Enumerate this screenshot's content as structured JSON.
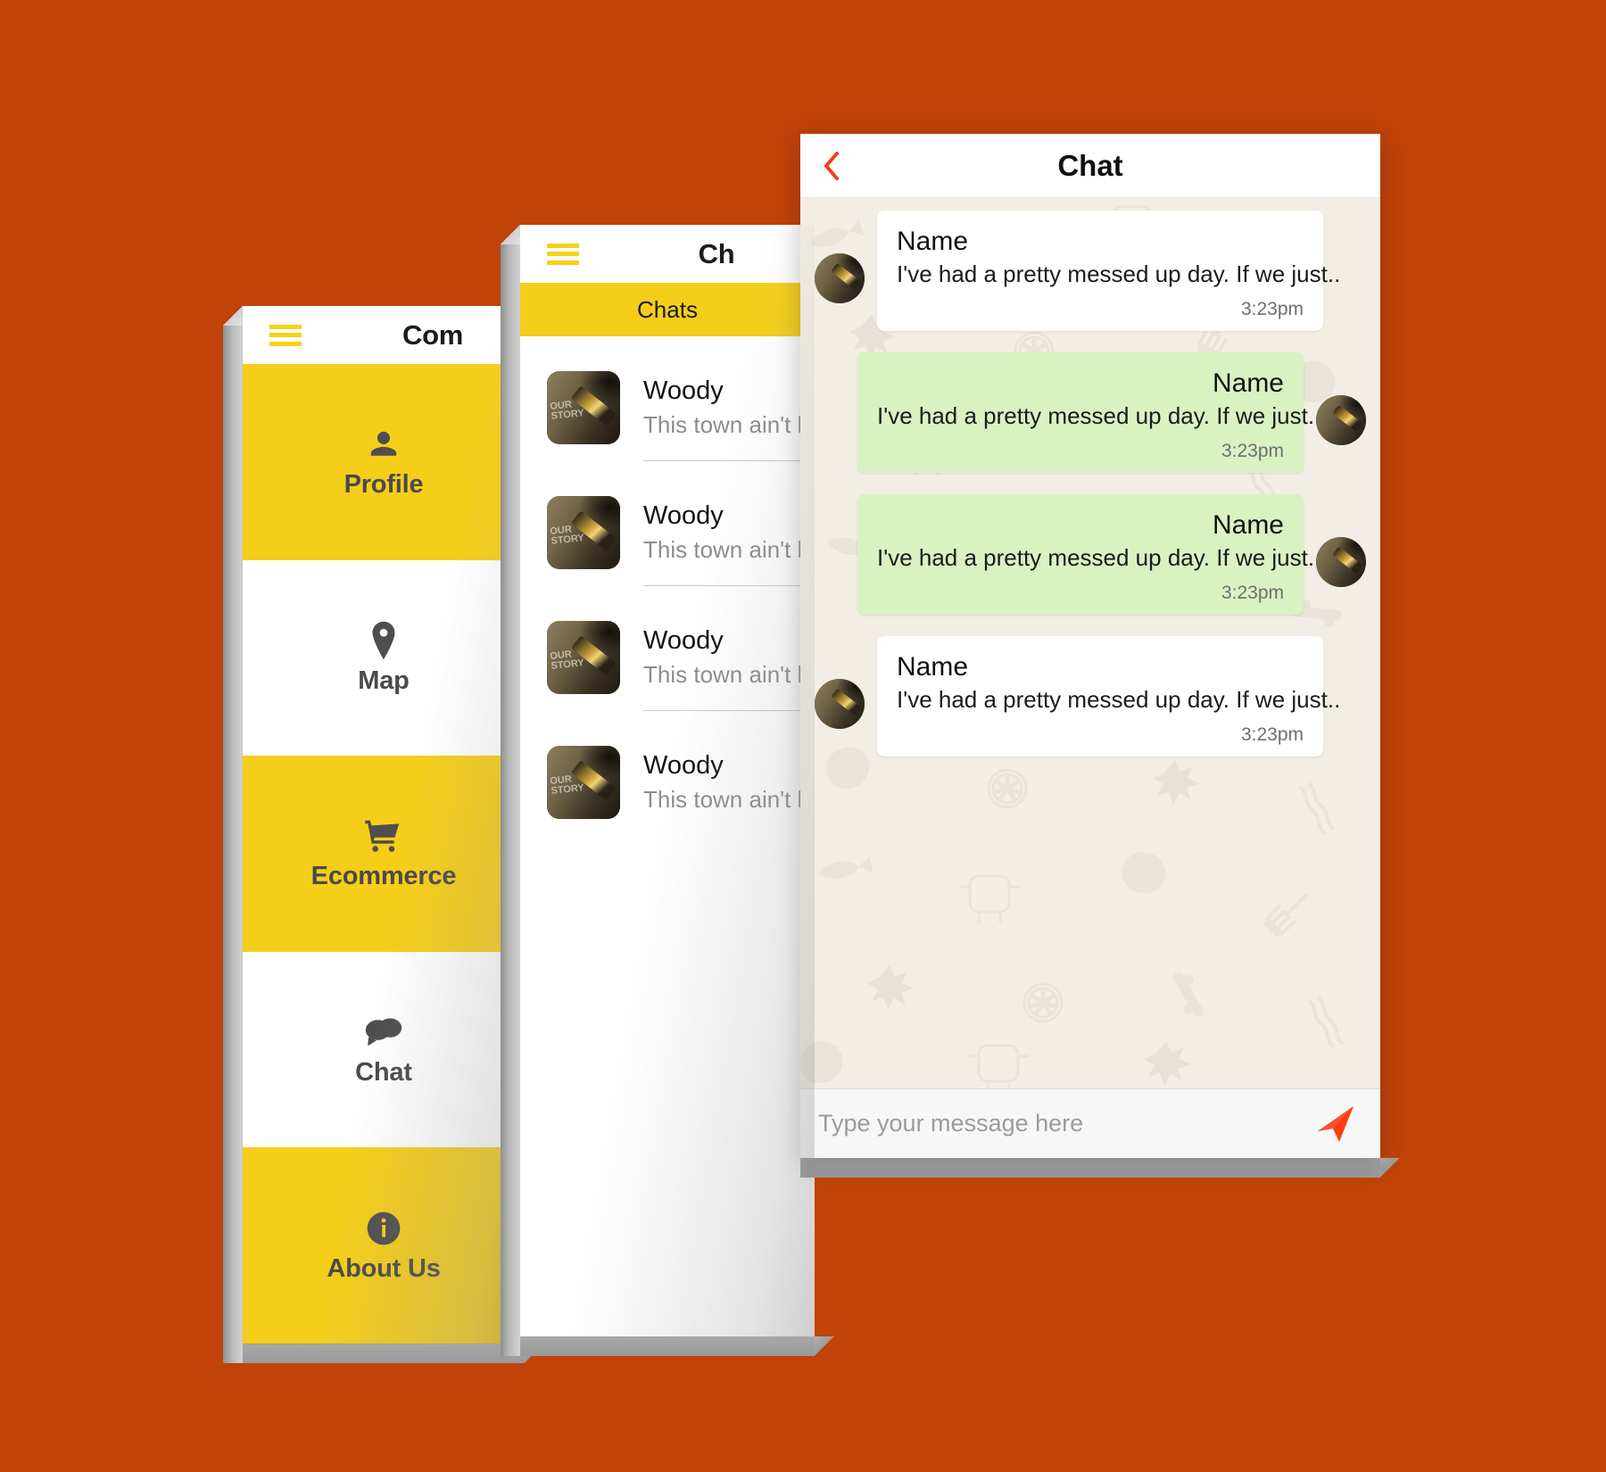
{
  "background_color": "#C04309",
  "accent_yellow": "#F5CE1A",
  "accent_red": "#F23E12",
  "bubble_out_green": "#D9F2C2",
  "drawer_screen": {
    "header": {
      "title": "Com",
      "menu_icon": "hamburger-icon"
    },
    "menu_items": [
      {
        "label": "Profile",
        "icon": "person-icon",
        "highlighted": true
      },
      {
        "label": "Map",
        "icon": "map-pin-icon",
        "highlighted": false
      },
      {
        "label": "Ecommerce",
        "icon": "cart-icon",
        "highlighted": true
      },
      {
        "label": "Chat",
        "icon": "chat-bubble-icon",
        "highlighted": false
      },
      {
        "label": "About Us",
        "icon": "info-icon",
        "highlighted": true
      }
    ]
  },
  "chat_list_screen": {
    "header": {
      "title": "Ch",
      "menu_icon": "hamburger-icon"
    },
    "tab": {
      "label": "Chats"
    },
    "avatar_caption": "OUR\nSTORY",
    "rows": [
      {
        "name": "Woody",
        "snippet": "This town ain't b"
      },
      {
        "name": "Woody",
        "snippet": "This town ain't b"
      },
      {
        "name": "Woody",
        "snippet": "This town ain't b"
      },
      {
        "name": "Woody",
        "snippet": "This town ain't b"
      }
    ]
  },
  "conversation_screen": {
    "header": {
      "title": "Chat",
      "back_icon": "back-chevron-icon"
    },
    "messages": [
      {
        "direction": "in",
        "name": "Name",
        "text": "I've had a pretty messed up day. If we just..",
        "time": "3:23pm"
      },
      {
        "direction": "out",
        "name": "Name",
        "text": "I've had a pretty messed up day. If we just.",
        "time": "3:23pm"
      },
      {
        "direction": "out",
        "name": "Name",
        "text": "I've had a pretty messed up day. If we just.",
        "time": "3:23pm"
      },
      {
        "direction": "in",
        "name": "Name",
        "text": "I've had a pretty messed up day. If we just..",
        "time": "3:23pm"
      }
    ],
    "composer": {
      "placeholder": "Type your message here",
      "value": "",
      "send_icon": "send-paper-plane-icon"
    }
  }
}
